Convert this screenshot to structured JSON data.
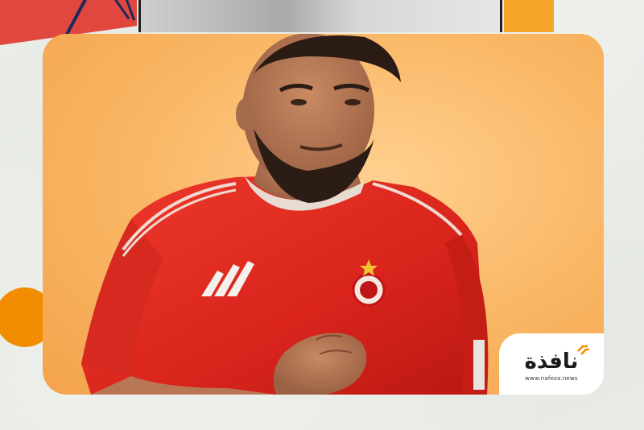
{
  "logo": {
    "word": "نافذة",
    "url": "www.nafeza.news",
    "accent": "#f28c00"
  },
  "colors": {
    "background": "#e4e7e1",
    "photo_backdrop": "#f9b562",
    "jersey": "#e0261f",
    "decor_red": "#e1473f",
    "decor_orange": "#f28c00"
  }
}
